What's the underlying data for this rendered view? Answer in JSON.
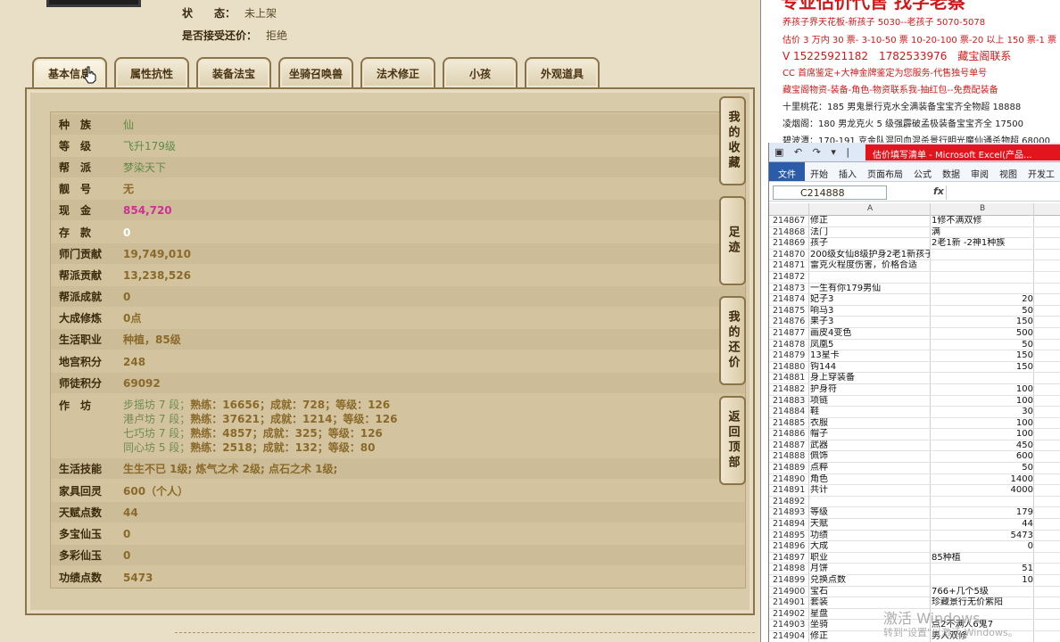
{
  "status": {
    "label": "状　　态：",
    "value": "未上架"
  },
  "accept_counter": {
    "label": "是否接受还价：",
    "value": "拒绝"
  },
  "tabs": [
    {
      "label": "基本信息"
    },
    {
      "label": "属性抗性"
    },
    {
      "label": "装备法宝"
    },
    {
      "label": "坐骑召唤兽"
    },
    {
      "label": "法术修正"
    },
    {
      "label": "小孩"
    },
    {
      "label": "外观道具"
    }
  ],
  "info": {
    "race": {
      "label": "种　族",
      "value": "仙"
    },
    "level": {
      "label": "等　级",
      "value": "飞升179级"
    },
    "faction": {
      "label": "帮　派",
      "value": "梦染天下"
    },
    "nice_id": {
      "label": "靓　号",
      "value": "无"
    },
    "cash": {
      "label": "现　金",
      "value": "854,720"
    },
    "savings": {
      "label": "存　款",
      "value": "0"
    },
    "school_contrib": {
      "label": "师门贡献",
      "value": "19,749,010"
    },
    "faction_contrib": {
      "label": "帮派贡献",
      "value": "13,238,526"
    },
    "faction_achieve": {
      "label": "帮派成就",
      "value": "0"
    },
    "dacheng": {
      "label": "大成修炼",
      "value": "0点"
    },
    "life_job": {
      "label": "生活职业",
      "value": "种植，85级"
    },
    "palace_points": {
      "label": "地宫积分",
      "value": "248"
    },
    "mentor_points": {
      "label": "师徒积分",
      "value": "69092"
    },
    "workshop": {
      "label": "作　坊",
      "lines": [
        {
          "name": "步摇坊 7 段；",
          "detail": "熟练：16656；成就：728；等级：126"
        },
        {
          "name": "港卢坊 7 段；",
          "detail": "熟练：37621；成就：1214；等级：126"
        },
        {
          "name": "七巧坊 7 段；",
          "detail": "熟练：4857；成就：325；等级：126"
        },
        {
          "name": "同心坊 5 段；",
          "detail": "熟练：2518；成就：132；等级：80"
        }
      ]
    },
    "life_skill": {
      "label": "生活技能",
      "value": "生生不已 1级; 炼气之术 2级; 点石之术 1级;"
    },
    "home_spirit": {
      "label": "家具回灵",
      "value": "600（个人）"
    },
    "talent": {
      "label": "天赋点数",
      "value": "44"
    },
    "duobao": {
      "label": "多宝仙玉",
      "value": "0"
    },
    "duocai": {
      "label": "多彩仙玉",
      "value": "0"
    },
    "merit": {
      "label": "功绩点数",
      "value": "5473"
    }
  },
  "side_buttons": [
    {
      "label": "我的收藏"
    },
    {
      "label": "足迹"
    },
    {
      "label": "我的还价"
    },
    {
      "label": "返回顶部"
    }
  ],
  "ads": {
    "title": "专业估价代售 找字老蔡",
    "lines": [
      "养孩子界天花板-新孩子 5030--老孩子 5070-5078",
      "估价 3 万内 30 票- 3-10-50 票 10-20-100 票-20 以上 150 票-1 票 1",
      "V 15225921182　1782533976　藏宝阁联系",
      "CC 首席鉴定+大神金牌鉴定为您服务-代售独号单号",
      "藏宝阁物资-装备-角色-物资联系我-抽红包--免费配装备",
      "十里桃花：185 男鬼景行克水全满装备宝宝齐全物超 18888",
      "凌烟阁：180 男龙克火 5 级强霹破孟极装备宝宝齐全 17500",
      "碧波潭：170-191 克金队混回血混杀景行明光魔仙通杀物超 68000"
    ]
  },
  "excel": {
    "quick_access": "▣ ↶ ↷ ▾ |",
    "caption": "估价填写清单 - Microsoft Excel(产品...",
    "ribbon_tabs": [
      "文件",
      "开始",
      "插入",
      "页面布局",
      "公式",
      "数据",
      "审阅",
      "视图",
      "开发工"
    ],
    "name_box": "C214888",
    "fx": "fx",
    "col_a": "A",
    "col_b": "B",
    "rows": [
      {
        "n": "214867",
        "a": "修正",
        "b": "1修不满双修"
      },
      {
        "n": "214868",
        "a": "法门",
        "b": "满"
      },
      {
        "n": "214869",
        "a": "孩子",
        "b": "2老1新 -2神1种族"
      },
      {
        "n": "214870",
        "a": "200级女仙8级护身2老1新孩子，51+6月饼，传世惊鸿",
        "b": ""
      },
      {
        "n": "214871",
        "a": "雷克火程度伤害，价格合适",
        "b": ""
      },
      {
        "n": "214872",
        "a": "",
        "b": ""
      },
      {
        "n": "214873",
        "a": "一生有你179男仙",
        "b": ""
      },
      {
        "n": "214874",
        "a": "妃子3",
        "b": "20"
      },
      {
        "n": "214875",
        "a": "响马3",
        "b": "50"
      },
      {
        "n": "214876",
        "a": "果子3",
        "b": "150"
      },
      {
        "n": "214877",
        "a": "画皮4变色",
        "b": "500"
      },
      {
        "n": "214878",
        "a": "凤凰5",
        "b": "50"
      },
      {
        "n": "214879",
        "a": "13星卡",
        "b": "150"
      },
      {
        "n": "214880",
        "a": "钩144",
        "b": "150"
      },
      {
        "n": "214881",
        "a": "身上穿装备",
        "b": ""
      },
      {
        "n": "214882",
        "a": "护身符",
        "b": "100"
      },
      {
        "n": "214883",
        "a": "项链",
        "b": "100"
      },
      {
        "n": "214884",
        "a": "鞋",
        "b": "30"
      },
      {
        "n": "214885",
        "a": "衣服",
        "b": "100"
      },
      {
        "n": "214886",
        "a": "帽子",
        "b": "100"
      },
      {
        "n": "214887",
        "a": "武器",
        "b": "450"
      },
      {
        "n": "214888",
        "a": "佩饰",
        "b": "600"
      },
      {
        "n": "214889",
        "a": "点粹",
        "b": "50"
      },
      {
        "n": "214890",
        "a": "角色",
        "b": "1400"
      },
      {
        "n": "214891",
        "a": "共计",
        "b": "4000"
      },
      {
        "n": "214892",
        "a": "",
        "b": ""
      },
      {
        "n": "214893",
        "a": "等级",
        "b": "179"
      },
      {
        "n": "214894",
        "a": "天赋",
        "b": "44"
      },
      {
        "n": "214895",
        "a": "功绩",
        "b": "5473"
      },
      {
        "n": "214896",
        "a": "大成",
        "b": "0"
      },
      {
        "n": "214897",
        "a": "职业",
        "b": "85种植"
      },
      {
        "n": "214898",
        "a": "月饼",
        "b": "51"
      },
      {
        "n": "214899",
        "a": "兑换点数",
        "b": "10"
      },
      {
        "n": "214900",
        "a": "宝石",
        "b": "766+几个5级"
      },
      {
        "n": "214901",
        "a": "套装",
        "b": "珍藏景行无价紫阳"
      },
      {
        "n": "214902",
        "a": "星盘",
        "b": ""
      },
      {
        "n": "214903",
        "a": "坐骑",
        "b": "点2不满人6鬼7"
      },
      {
        "n": "214904",
        "a": "修正",
        "b": "男人双修"
      }
    ],
    "numeric_rows": [
      "214874",
      "214875",
      "214876",
      "214877",
      "214878",
      "214879",
      "214880",
      "214882",
      "214883",
      "214884",
      "214885",
      "214886",
      "214887",
      "214888",
      "214889",
      "214890",
      "214891",
      "214893",
      "214894",
      "214895",
      "214896",
      "214898",
      "214899"
    ]
  },
  "watermark": {
    "line1": "激活 Windows",
    "line2": "转到\"设置\"以激活 Windows。"
  }
}
